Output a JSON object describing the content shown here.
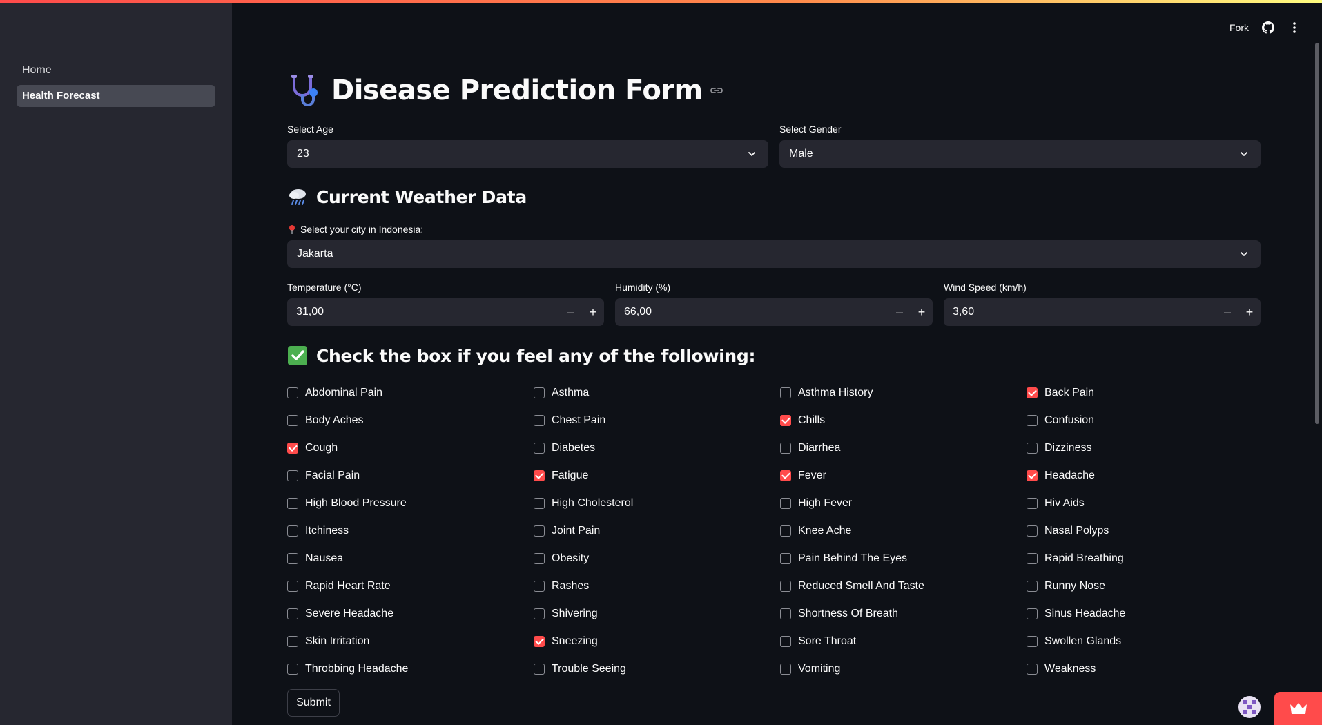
{
  "sidebar": {
    "items": [
      {
        "label": "Home",
        "active": false
      },
      {
        "label": "Health Forecast",
        "active": true
      }
    ]
  },
  "header": {
    "fork_label": "Fork",
    "github_icon": "github-icon",
    "menu_icon": "kebab-menu-icon"
  },
  "title": {
    "emoji": "stethoscope-icon",
    "text": "Disease Prediction Form",
    "link_icon": "link-icon"
  },
  "age": {
    "label": "Select Age",
    "value": "23"
  },
  "gender": {
    "label": "Select Gender",
    "value": "Male"
  },
  "weather": {
    "heading": "Current Weather Data",
    "emoji": "cloud-rain-icon",
    "city_label": "Select your city in Indonesia:",
    "city_icon": "pin-icon",
    "city_value": "Jakarta",
    "temperature": {
      "label": "Temperature (°C)",
      "value": "31,00"
    },
    "humidity": {
      "label": "Humidity (%)",
      "value": "66,00"
    },
    "wind": {
      "label": "Wind Speed (km/h)",
      "value": "3,60"
    },
    "minus": "–",
    "plus": "+"
  },
  "symptoms": {
    "heading": "Check the box if you feel any of the following:",
    "emoji": "check-box-icon",
    "items": [
      {
        "label": "Abdominal Pain",
        "checked": false
      },
      {
        "label": "Asthma",
        "checked": false
      },
      {
        "label": "Asthma History",
        "checked": false
      },
      {
        "label": "Back Pain",
        "checked": true
      },
      {
        "label": "Body Aches",
        "checked": false
      },
      {
        "label": "Chest Pain",
        "checked": false
      },
      {
        "label": "Chills",
        "checked": true
      },
      {
        "label": "Confusion",
        "checked": false
      },
      {
        "label": "Cough",
        "checked": true
      },
      {
        "label": "Diabetes",
        "checked": false
      },
      {
        "label": "Diarrhea",
        "checked": false
      },
      {
        "label": "Dizziness",
        "checked": false
      },
      {
        "label": "Facial Pain",
        "checked": false
      },
      {
        "label": "Fatigue",
        "checked": true
      },
      {
        "label": "Fever",
        "checked": true
      },
      {
        "label": "Headache",
        "checked": true
      },
      {
        "label": "High Blood Pressure",
        "checked": false
      },
      {
        "label": "High Cholesterol",
        "checked": false
      },
      {
        "label": "High Fever",
        "checked": false
      },
      {
        "label": "Hiv Aids",
        "checked": false
      },
      {
        "label": "Itchiness",
        "checked": false
      },
      {
        "label": "Joint Pain",
        "checked": false
      },
      {
        "label": "Knee Ache",
        "checked": false
      },
      {
        "label": "Nasal Polyps",
        "checked": false
      },
      {
        "label": "Nausea",
        "checked": false
      },
      {
        "label": "Obesity",
        "checked": false
      },
      {
        "label": "Pain Behind The Eyes",
        "checked": false
      },
      {
        "label": "Rapid Breathing",
        "checked": false
      },
      {
        "label": "Rapid Heart Rate",
        "checked": false
      },
      {
        "label": "Rashes",
        "checked": false
      },
      {
        "label": "Reduced Smell And Taste",
        "checked": false
      },
      {
        "label": "Runny Nose",
        "checked": false
      },
      {
        "label": "Severe Headache",
        "checked": false
      },
      {
        "label": "Shivering",
        "checked": false
      },
      {
        "label": "Shortness Of Breath",
        "checked": false
      },
      {
        "label": "Sinus Headache",
        "checked": false
      },
      {
        "label": "Skin Irritation",
        "checked": false
      },
      {
        "label": "Sneezing",
        "checked": true
      },
      {
        "label": "Sore Throat",
        "checked": false
      },
      {
        "label": "Swollen Glands",
        "checked": false
      },
      {
        "label": "Throbbing Headache",
        "checked": false
      },
      {
        "label": "Trouble Seeing",
        "checked": false
      },
      {
        "label": "Vomiting",
        "checked": false
      },
      {
        "label": "Weakness",
        "checked": false
      }
    ]
  },
  "submit_label": "Submit",
  "colors": {
    "accent": "#ff4b4b",
    "background": "#0e1117",
    "sidebar": "#262730"
  }
}
